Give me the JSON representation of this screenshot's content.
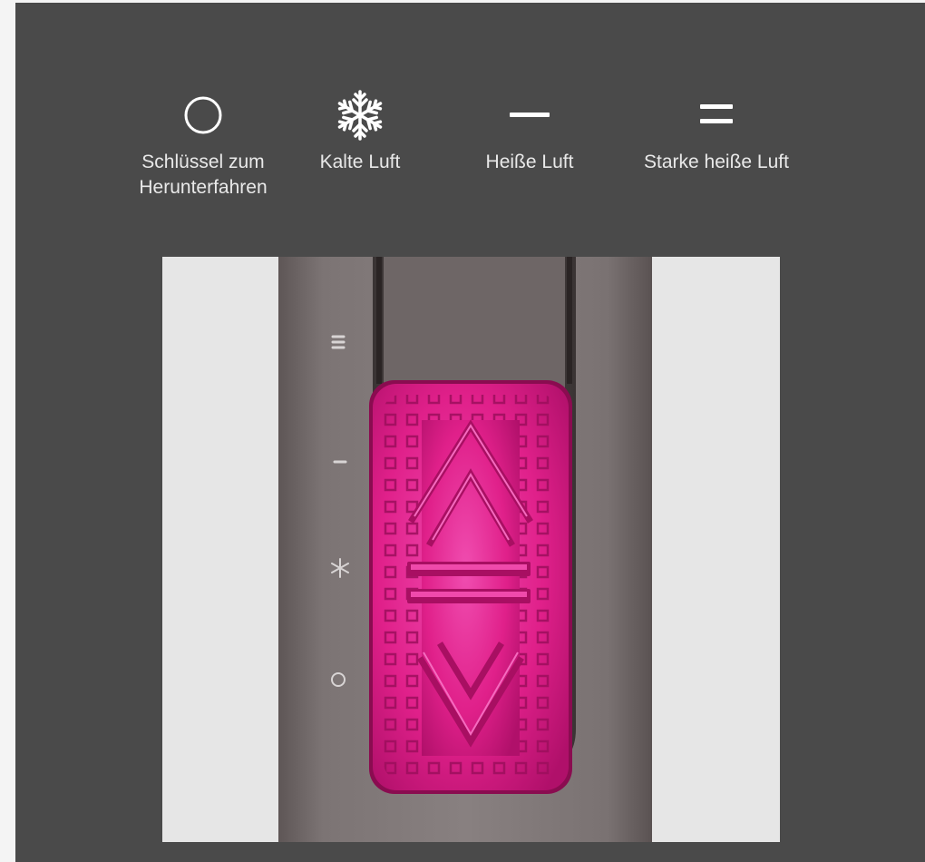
{
  "legend": {
    "items": [
      {
        "icon": "circle-icon",
        "label_line1": "Schlüssel zum",
        "label_line2": "Herunterfahren"
      },
      {
        "icon": "snowflake-icon",
        "label_line1": "Kalte Luft",
        "label_line2": ""
      },
      {
        "icon": "single-dash-icon",
        "label_line1": "Heiße Luft",
        "label_line2": ""
      },
      {
        "icon": "double-dash-icon",
        "label_line1": "Starke heiße Luft",
        "label_line2": ""
      }
    ]
  },
  "photo": {
    "subject": "hair styler switch",
    "colors": {
      "background": "#4a4a4a",
      "body": "#7a7272",
      "switch": "#e0208a",
      "panel": "#e6e6e6"
    }
  }
}
